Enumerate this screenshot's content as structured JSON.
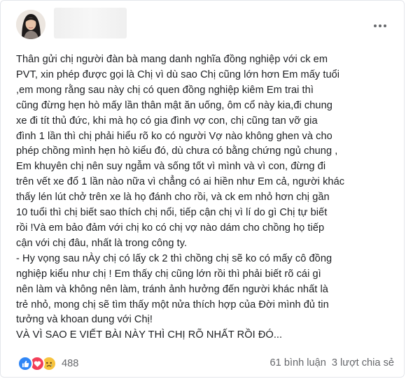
{
  "post": {
    "body": "Thân gửi chị người đàn bà mang danh nghĩa đồng nghiệp với ck em\nPVT, xin phép được gọi là Chị vì dù sao Chị cũng lớn hơn Em mấy tuổi\n,em mong rằng sau này chị có quen đồng nghiệp kiêm Em trai thì\ncũng đừng hẹn hò mấy lần thân mật ăn uống, ôm cổ này kia,đi chung\nxe đi tít thủ đức, khi mà họ có gia đình vợ con, chị cũng tan vỡ gia\nđình 1 lần thì chị phải hiểu rõ ko có người Vợ nào không ghen và cho\nphép chồng mình hẹn hò kiểu đó, dù chưa có bằng chứng ngủ chung ,\nEm khuyên chị nên suy ngẫm và sống tốt vì mình và vì con, đừng đi\ntrên vết xe đổ 1 lần nào nữa vì chẳng có ai hiền như Em cả, người khác\nthấy lén lút chở trên xe là họ đánh cho rồi, và ck em nhỏ hơn chị gần\n10 tuổi thì chị biết sao thích chị nổi, tiếp cận chị vì lí do gì Chị tự biết\nrồi !Và em bảo đảm với chị ko có chị vợ nào dám cho chồng họ tiếp\ncận với chị đâu, nhất là trong công ty.\n- Hy vọng sau nÀy chị có lấy ck 2 thì chồng chị sẽ ko có mấy cô đồng\nnghiệp kiểu như chị ! Em thấy chị cũng lớn rồi thì phải biết rõ cái gì\nnên làm và không nên làm, tránh ảnh hưởng đến người khác nhất là\ntrẻ nhỏ, mong chị sẽ tìm thấy một nửa thích hợp của Đời mình đủ tin\ntưởng và khoan dung với Chị!\nVÀ VÌ SAO E VIẾT BÀI NÀY THÌ CHỊ RÕ NHẤT RỒI ĐÓ...",
    "reaction_count": "488",
    "comments": "61 bình luận",
    "shares": "3 lượt chia sẻ"
  },
  "icons": {
    "more": "more-horizontal-icon",
    "like": "like-reaction-icon",
    "love": "love-reaction-icon",
    "sad": "sad-reaction-icon"
  },
  "colors": {
    "like": "#2f86f6",
    "love": "#f33e58",
    "sad": "#f7c33d",
    "meta_text": "#65676b"
  }
}
